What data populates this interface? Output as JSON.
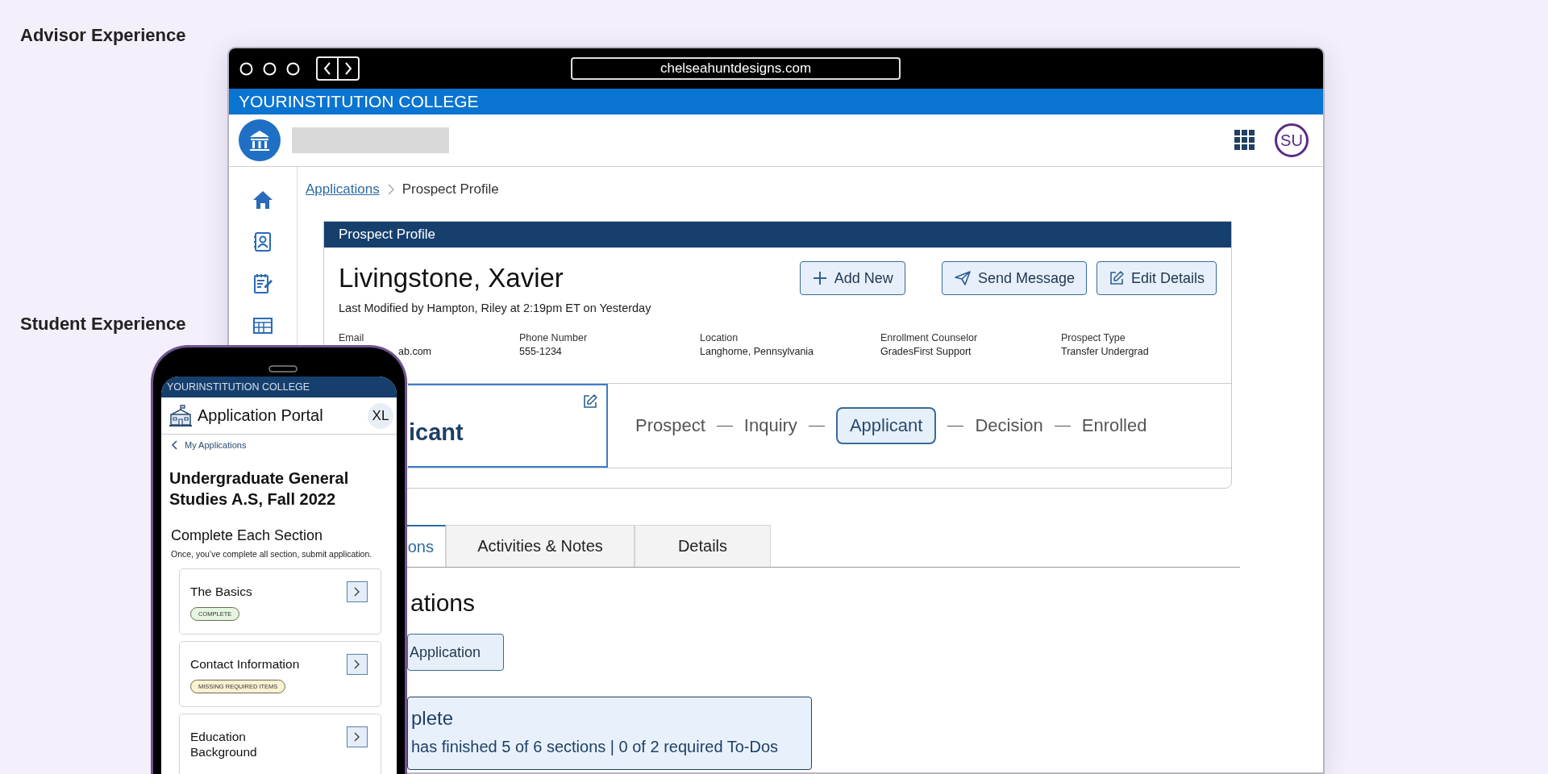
{
  "advisor_label": "Advisor Experience",
  "student_label": "Student Experience",
  "browser": {
    "url": "chelseahuntdesigns.com",
    "banner": "YOURINSTITUTION COLLEGE",
    "avatar": "SU",
    "breadcrumb": [
      {
        "label": "Applications",
        "kind": "link"
      },
      {
        "label": "Prospect Profile",
        "kind": "current"
      }
    ],
    "profile": {
      "header": "Prospect Profile",
      "name": "Livingstone, Xavier",
      "last_modified": "Last Modified by Hampton, Riley at 2:19pm ET on Yesterday",
      "actions": [
        {
          "label": "Add New",
          "kind": "add"
        },
        {
          "label": "Send Message",
          "kind": "send"
        },
        {
          "label": "Edit Details",
          "kind": "edit"
        }
      ],
      "fields": [
        {
          "label": "Email",
          "value": "ab.com"
        },
        {
          "label": "Phone Number",
          "value": "555-1234"
        },
        {
          "label": "Location",
          "value": "Langhorne, Pennsylvania"
        },
        {
          "label": "Enrollment Counselor",
          "value": "GradesFirst Support"
        },
        {
          "label": "Prospect Type",
          "value": "Transfer Undergrad"
        }
      ],
      "current_stage": "icant",
      "stages": [
        {
          "label": "Prospect",
          "selected": false
        },
        {
          "label": "Inquiry",
          "selected": false
        },
        {
          "label": "Applicant",
          "selected": true
        },
        {
          "label": "Decision",
          "selected": false
        },
        {
          "label": "Enrolled",
          "selected": false
        }
      ]
    },
    "tabs": [
      {
        "label": "ons",
        "selected": true
      },
      {
        "label": "Activities & Notes",
        "selected": false
      },
      {
        "label": "Details",
        "selected": false
      }
    ],
    "section_title": "ations",
    "button": "Application",
    "status_card": {
      "title": "plete",
      "summary": "has finished 5 of 6 sections | 0 of 2 required To-Dos"
    }
  },
  "phone": {
    "banner": "YOURINSTITUTION COLLEGE",
    "title": "Application Portal",
    "avatar": "XL",
    "back_link": "My Applications",
    "program": "Undergraduate General Studies A.S, Fall 2022",
    "heading": "Complete Each Section",
    "instructions": "Once, you’ve complete all section, submit application.",
    "sections": [
      {
        "title": "The Basics",
        "badge": "COMPLETE",
        "color": "#e4f5e0"
      },
      {
        "title": "Contact Information",
        "badge": "MISSING REQUIRED ITEMS",
        "color": "#fbf2d2"
      },
      {
        "title": "Education Background"
      }
    ]
  }
}
